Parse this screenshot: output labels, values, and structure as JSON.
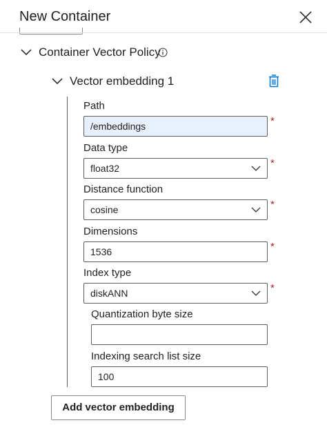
{
  "panel": {
    "title": "New Container"
  },
  "vector_policy": {
    "title": "Container Vector Policy"
  },
  "embedding": {
    "title": "Vector embedding 1",
    "path": {
      "label": "Path",
      "value": "/embeddings"
    },
    "data_type": {
      "label": "Data type",
      "value": "float32"
    },
    "distance_function": {
      "label": "Distance function",
      "value": "cosine"
    },
    "dimensions": {
      "label": "Dimensions",
      "value": "1536"
    },
    "index_type": {
      "label": "Index type",
      "value": "diskANN"
    },
    "quantization_byte_size": {
      "label": "Quantization byte size",
      "value": ""
    },
    "indexing_search_list_size": {
      "label": "Indexing search list size",
      "value": "100"
    },
    "required_marker": "*"
  },
  "actions": {
    "add_label": "Add vector embedding"
  },
  "colors": {
    "accent": "#0078d4",
    "required": "#a4262c",
    "focused_fill": "#e8f0fe"
  },
  "icons": [
    "close-icon",
    "chevron-down-icon",
    "info-icon",
    "trash-icon"
  ]
}
